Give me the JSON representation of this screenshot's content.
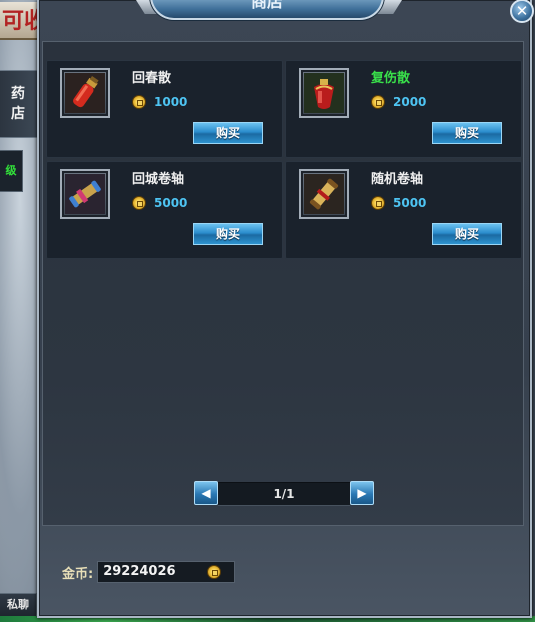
{
  "window": {
    "title": "商店",
    "close_glyph": "✕"
  },
  "background": {
    "banner_text": "可收",
    "side_tab_label": [
      "药",
      "店"
    ],
    "side_chip_text": "级",
    "private_chat_label": "私聊"
  },
  "items": [
    {
      "name": "回春散",
      "price": "1000",
      "buy_label": "购买",
      "name_color": "#f0f0f0",
      "icon": "red-potion-vial-icon"
    },
    {
      "name": "复伤散",
      "price": "2000",
      "buy_label": "购买",
      "name_color": "#39e04a",
      "icon": "red-potion-bottle-icon"
    },
    {
      "name": "回城卷轴",
      "price": "5000",
      "buy_label": "购买",
      "name_color": "#f0f0f0",
      "icon": "blue-scroll-icon"
    },
    {
      "name": "随机卷轴",
      "price": "5000",
      "buy_label": "购买",
      "name_color": "#f0f0f0",
      "icon": "gold-scroll-icon"
    }
  ],
  "pagination": {
    "page_text": "1/1",
    "prev_glyph": "◀",
    "next_glyph": "▶"
  },
  "wallet": {
    "label": "金币:",
    "amount": "29224026",
    "currency_icon": "gold-coin-icon"
  },
  "colors": {
    "price_text": "#4ec4f2",
    "highlight_name": "#39e04a",
    "button_blue": "#2a8ccc"
  }
}
